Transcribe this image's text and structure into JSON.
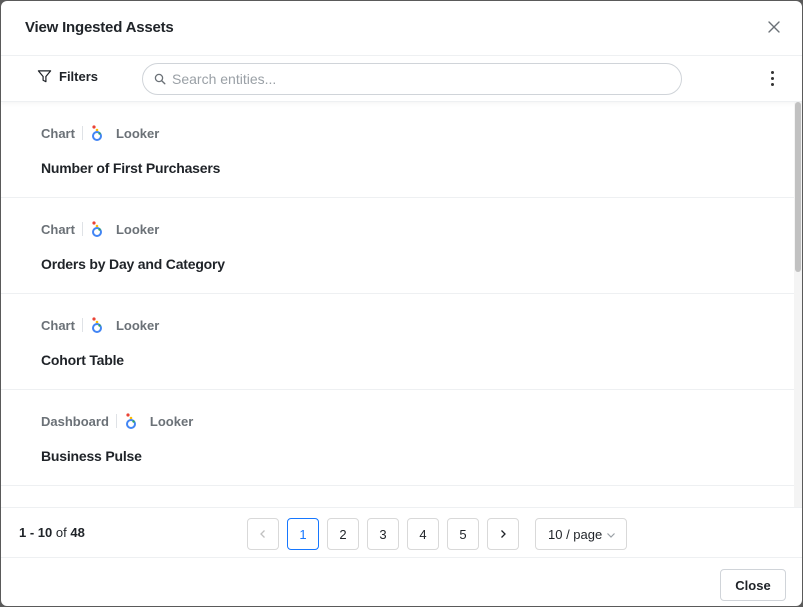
{
  "modal": {
    "title": "View Ingested Assets",
    "close_label": "Close"
  },
  "toolbar": {
    "filters_label": "Filters",
    "search_placeholder": "Search entities..."
  },
  "items": [
    {
      "type": "Chart",
      "source": "Looker",
      "name": "Number of First Purchasers"
    },
    {
      "type": "Chart",
      "source": "Looker",
      "name": "Orders by Day and Category"
    },
    {
      "type": "Chart",
      "source": "Looker",
      "name": "Cohort Table"
    },
    {
      "type": "Dashboard",
      "source": "Looker",
      "name": "Business Pulse"
    }
  ],
  "pagination": {
    "range": "1 - 10",
    "of_label": "of",
    "total": "48",
    "pages": [
      "1",
      "2",
      "3",
      "4",
      "5"
    ],
    "current_page": "1",
    "page_size": "10 / page",
    "prev_icon": "chevron-left-icon",
    "next_icon": "chevron-right-icon"
  },
  "colors": {
    "accent": "#1677ff",
    "text": "#1f2328",
    "muted": "#6b7177"
  }
}
